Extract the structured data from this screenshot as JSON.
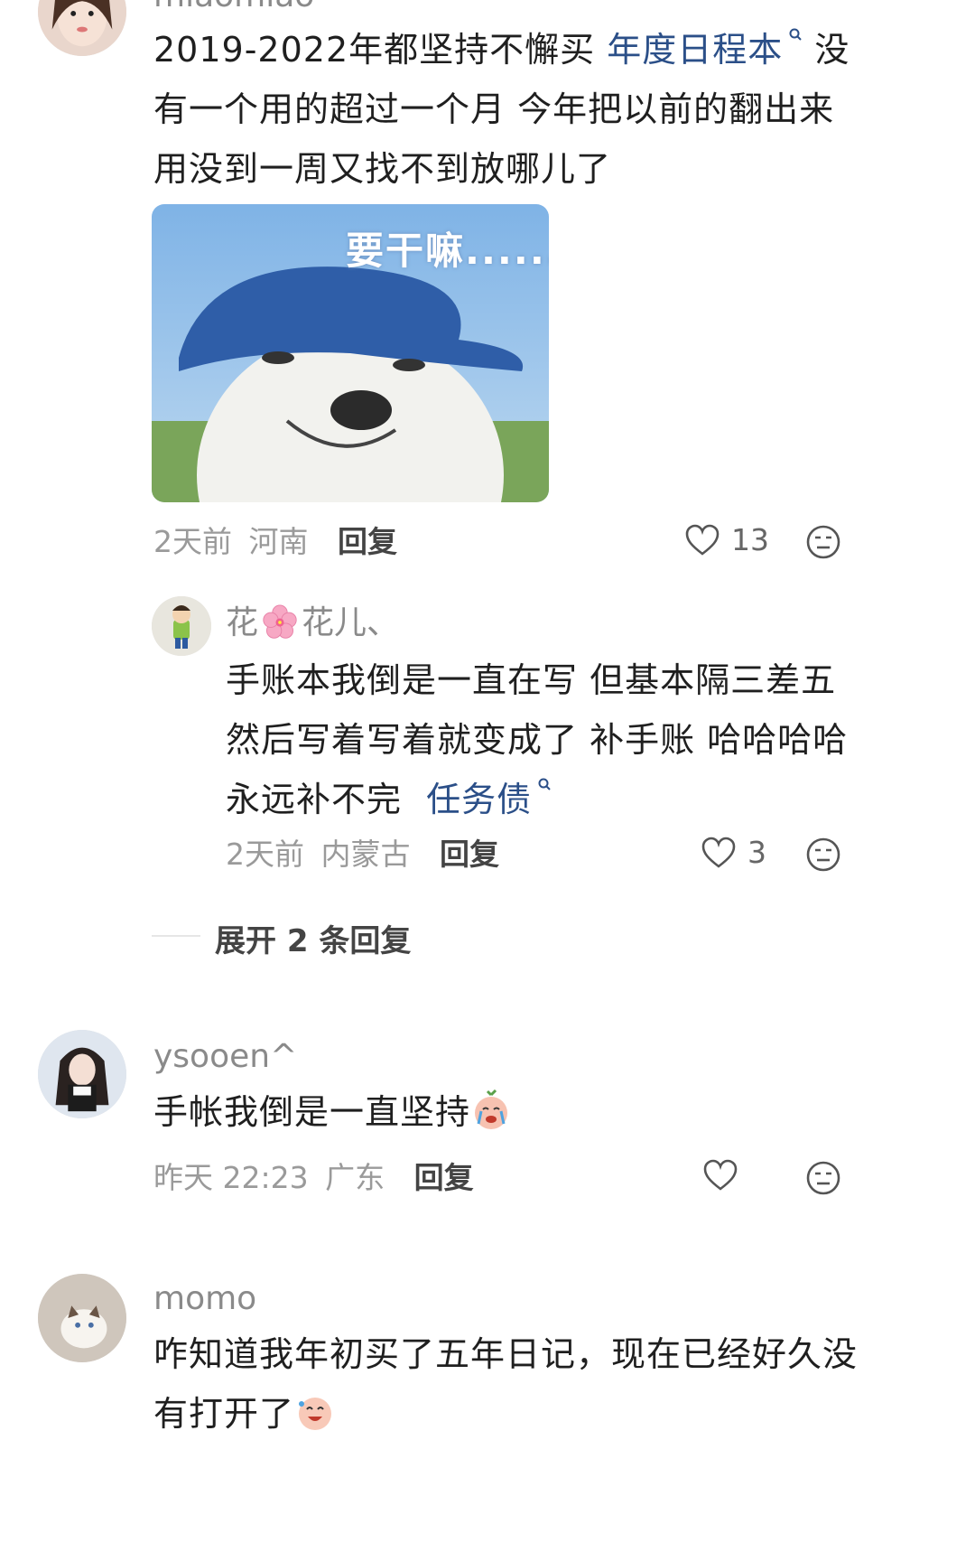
{
  "comments": [
    {
      "username": "miaomiao",
      "text_parts": [
        "2019-2022年都坚持不懈买",
        "年度日程本",
        "没有一个用的超过一个月 今年把以前的翻出来用没到一周又找不到放哪儿了"
      ],
      "sticker_caption": "要干嘛......",
      "time": "2天前",
      "location": "河南",
      "reply_label": "回复",
      "likes": "13"
    },
    {
      "username_a": "花",
      "username_b": "花儿、",
      "text_parts": [
        "手账本我倒是一直在写 但基本隔三差五然后写着写着就变成了 补手账 哈哈哈哈永远补不完",
        "任务债"
      ],
      "time": "2天前",
      "location": "内蒙古",
      "reply_label": "回复",
      "likes": "3"
    },
    {
      "username": "ysooen^",
      "text": "手帐我倒是一直坚持",
      "time": "昨天 22:23",
      "location": "广东",
      "reply_label": "回复",
      "likes": ""
    },
    {
      "username": "momo",
      "text_line1": "咋知道我年初买了五年日记，现在已经好久没",
      "text_line2": "有打开了"
    }
  ],
  "expand_replies": "展开 2 条回复",
  "icons": {
    "like": "heart-outline-icon",
    "dislike": "neutral-face-icon",
    "search_link": "search-link-icon",
    "flower": "cherry-blossom-icon",
    "crying": "crying-peach-emoji",
    "laughing": "laughing-emoji"
  },
  "colors": {
    "link": "#2b4f88",
    "meta": "#9a9a9a",
    "username": "#8a8a8a"
  }
}
